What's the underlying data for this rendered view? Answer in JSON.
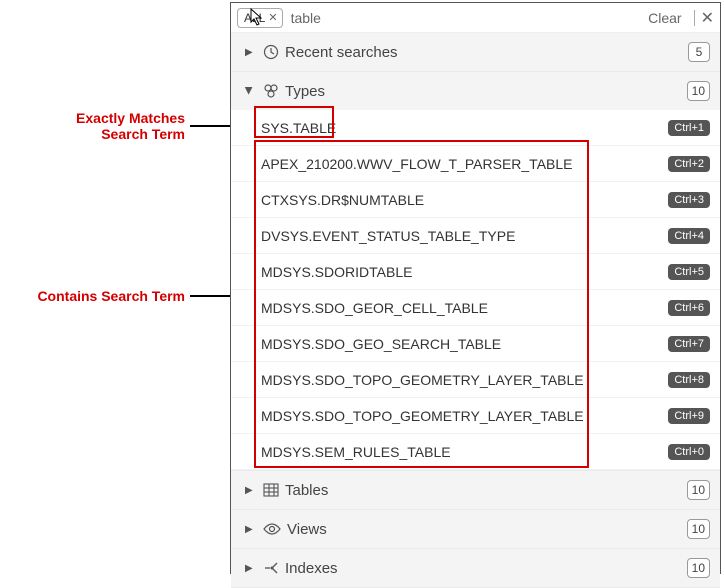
{
  "search": {
    "chip_label": "ALL",
    "value": "table",
    "clear_label": "Clear"
  },
  "sections": {
    "recent": {
      "title": "Recent searches",
      "count": "5"
    },
    "types": {
      "title": "Types",
      "count": "10"
    },
    "tables": {
      "title": "Tables",
      "count": "10"
    },
    "views": {
      "title": "Views",
      "count": "10"
    },
    "indexes": {
      "title": "Indexes",
      "count": "10"
    }
  },
  "type_rows": [
    {
      "label": "SYS.TABLE",
      "kbd": "Ctrl+1"
    },
    {
      "label": "APEX_210200.WWV_FLOW_T_PARSER_TABLE",
      "kbd": "Ctrl+2"
    },
    {
      "label": "CTXSYS.DR$NUMTABLE",
      "kbd": "Ctrl+3"
    },
    {
      "label": "DVSYS.EVENT_STATUS_TABLE_TYPE",
      "kbd": "Ctrl+4"
    },
    {
      "label": "MDSYS.SDORIDTABLE",
      "kbd": "Ctrl+5"
    },
    {
      "label": "MDSYS.SDO_GEOR_CELL_TABLE",
      "kbd": "Ctrl+6"
    },
    {
      "label": "MDSYS.SDO_GEO_SEARCH_TABLE",
      "kbd": "Ctrl+7"
    },
    {
      "label": "MDSYS.SDO_TOPO_GEOMETRY_LAYER_TABLE",
      "kbd": "Ctrl+8"
    },
    {
      "label": "MDSYS.SDO_TOPO_GEOMETRY_LAYER_TABLE",
      "kbd": "Ctrl+9"
    },
    {
      "label": "MDSYS.SEM_RULES_TABLE",
      "kbd": "Ctrl+0"
    }
  ],
  "annotations": {
    "exact": "Exactly Matches\nSearch Term",
    "contains": "Contains Search Term"
  }
}
